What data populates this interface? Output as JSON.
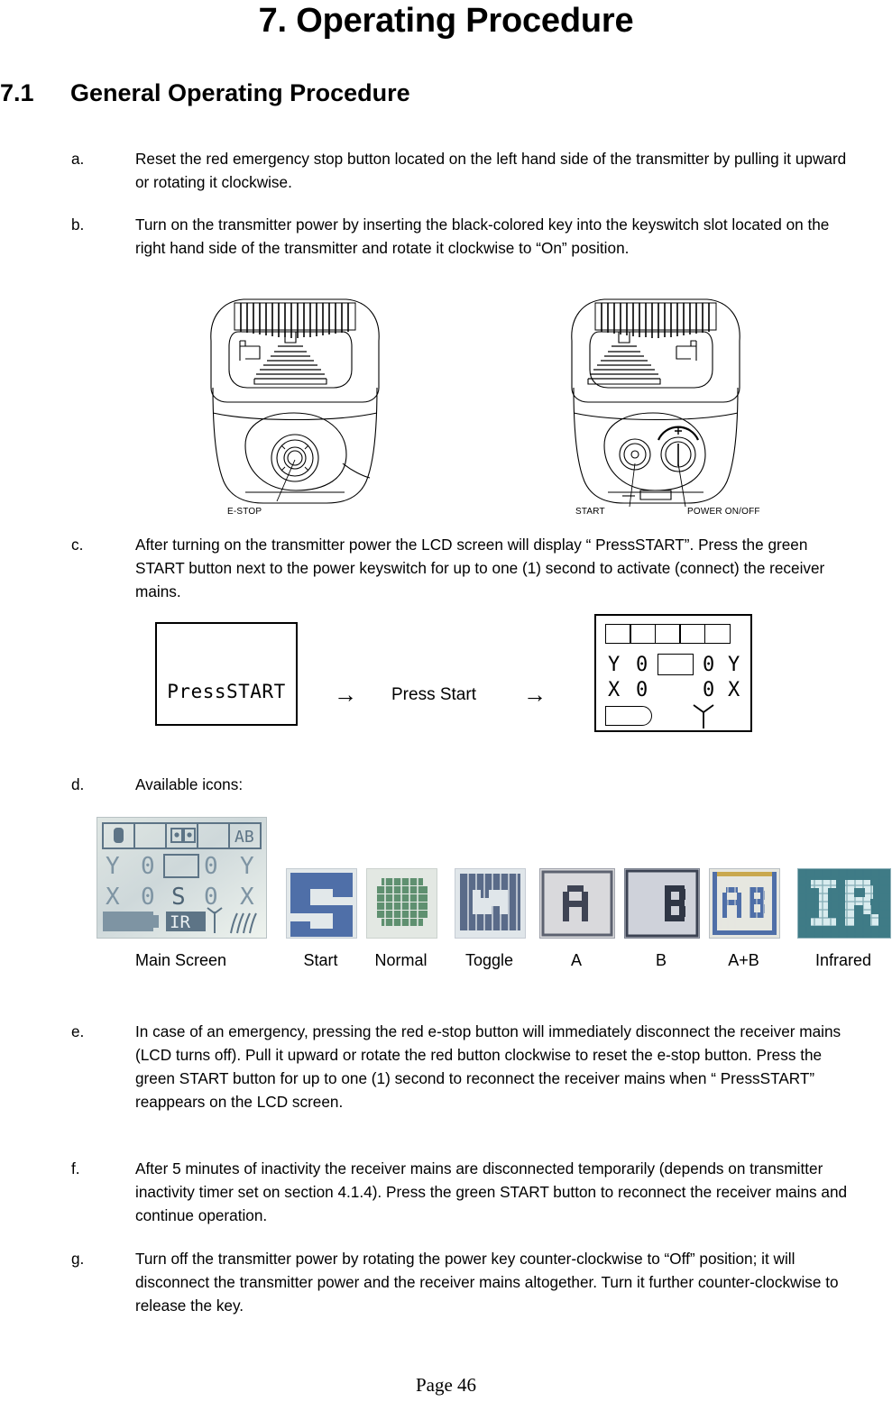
{
  "document": {
    "chapter_title": "7. Operating Procedure",
    "section_number": "7.1",
    "section_title": "General Operating Procedure",
    "footer": "Page 46"
  },
  "items": [
    {
      "letter": "a.",
      "text": "Reset the red emergency stop button located on the left hand side of the transmitter by pulling it upward or rotating it clockwise."
    },
    {
      "letter": "b.",
      "text": "Turn on the transmitter power by inserting the black-colored key into the keyswitch slot located on the right hand side of the transmitter and rotate it clockwise to “On” position."
    },
    {
      "letter": "c.",
      "text": "After turning on the transmitter power the LCD screen will display “ PressSTART”. Press the green START button next to the power keyswitch for up to one (1) second to activate (connect) the receiver mains."
    },
    {
      "letter": "d.",
      "text": "Available icons:"
    },
    {
      "letter": "e.",
      "text": "In case of an emergency, pressing the red e-stop button will immediately disconnect the receiver mains (LCD turns off). Pull it upward or rotate the red button clockwise to reset the e-stop button. Press the green START button for up to one (1) second to reconnect the receiver mains when “ PressSTART” reappears on the LCD screen."
    },
    {
      "letter": "f.",
      "text": "After 5 minutes of inactivity the receiver mains are disconnected temporarily (depends on transmitter inactivity timer set on section 4.1.4). Press the green START button to reconnect the receiver mains and continue operation."
    },
    {
      "letter": "g.",
      "text": "Turn off the transmitter power by rotating the power key counter-clockwise to “Off” position; it will disconnect the transmitter power and the receiver mains altogether. Turn it further counter-clockwise to release the key."
    }
  ],
  "figure_transmitters": {
    "left_label": "E-STOP",
    "right_label_1": "START",
    "right_label_2": "POWER ON/OFF"
  },
  "figure_lcd_flow": {
    "screen_before_text": "PressSTART",
    "arrow_1": "→",
    "action_label": "Press Start",
    "arrow_2": "→",
    "screen_after": {
      "status_cells": [
        "",
        "",
        "",
        "",
        ""
      ],
      "row_y": [
        "Y",
        "0",
        "0",
        "Y"
      ],
      "row_x": [
        "X",
        "0",
        "0",
        "X"
      ],
      "battery": "",
      "antenna": "Ψ"
    }
  },
  "figure_icons": {
    "items": [
      {
        "caption": "Main Screen",
        "icon": "lcd-main-screen-icon"
      },
      {
        "caption": "Start",
        "icon": "start-s-icon"
      },
      {
        "caption": "Normal",
        "icon": "normal-block-icon"
      },
      {
        "caption": "Toggle",
        "icon": "toggle-icon"
      },
      {
        "caption": "A",
        "icon": "a-icon"
      },
      {
        "caption": "B",
        "icon": "b-icon"
      },
      {
        "caption": "A+B",
        "icon": "ab-icon"
      },
      {
        "caption": "Infrared",
        "icon": "ir-icon"
      }
    ]
  },
  "colors": {
    "ink": "#000000",
    "paper": "#ffffff",
    "lcd_blue": "#4f6fa8",
    "lcd_green": "#5f9070",
    "lcd_face": "#cfd8dc",
    "ir_teal": "#3f7b86"
  }
}
